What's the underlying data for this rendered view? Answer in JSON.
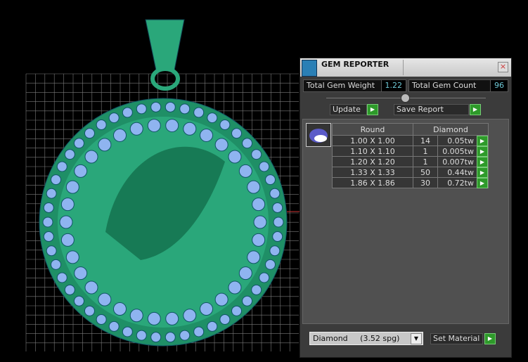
{
  "panel": {
    "title": "GEM REPORTER",
    "close": "×",
    "total_weight_label": "Total Gem Weight",
    "total_weight": "1.22",
    "total_count_label": "Total Gem Count",
    "total_count": "96",
    "update_label": "Update",
    "save_label": "Save Report",
    "table": {
      "headers": [
        "Round",
        "Diamond"
      ],
      "rows": [
        {
          "size": "1.00 X 1.00",
          "count": "14",
          "weight": "0.05tw"
        },
        {
          "size": "1.10 X 1.10",
          "count": "1",
          "weight": "0.005tw"
        },
        {
          "size": "1.20 X 1.20",
          "count": "1",
          "weight": "0.007tw"
        },
        {
          "size": "1.33 X 1.33",
          "count": "50",
          "weight": "0.44tw"
        },
        {
          "size": "1.86 X 1.86",
          "count": "30",
          "weight": "0.72tw"
        }
      ]
    },
    "material_select": "Diamond     (3.52 spg)",
    "set_material_label": "Set Material"
  },
  "colors": {
    "metal": "#2aa77a",
    "gem": "#8fb4f0",
    "go": "#2e9a2a"
  }
}
